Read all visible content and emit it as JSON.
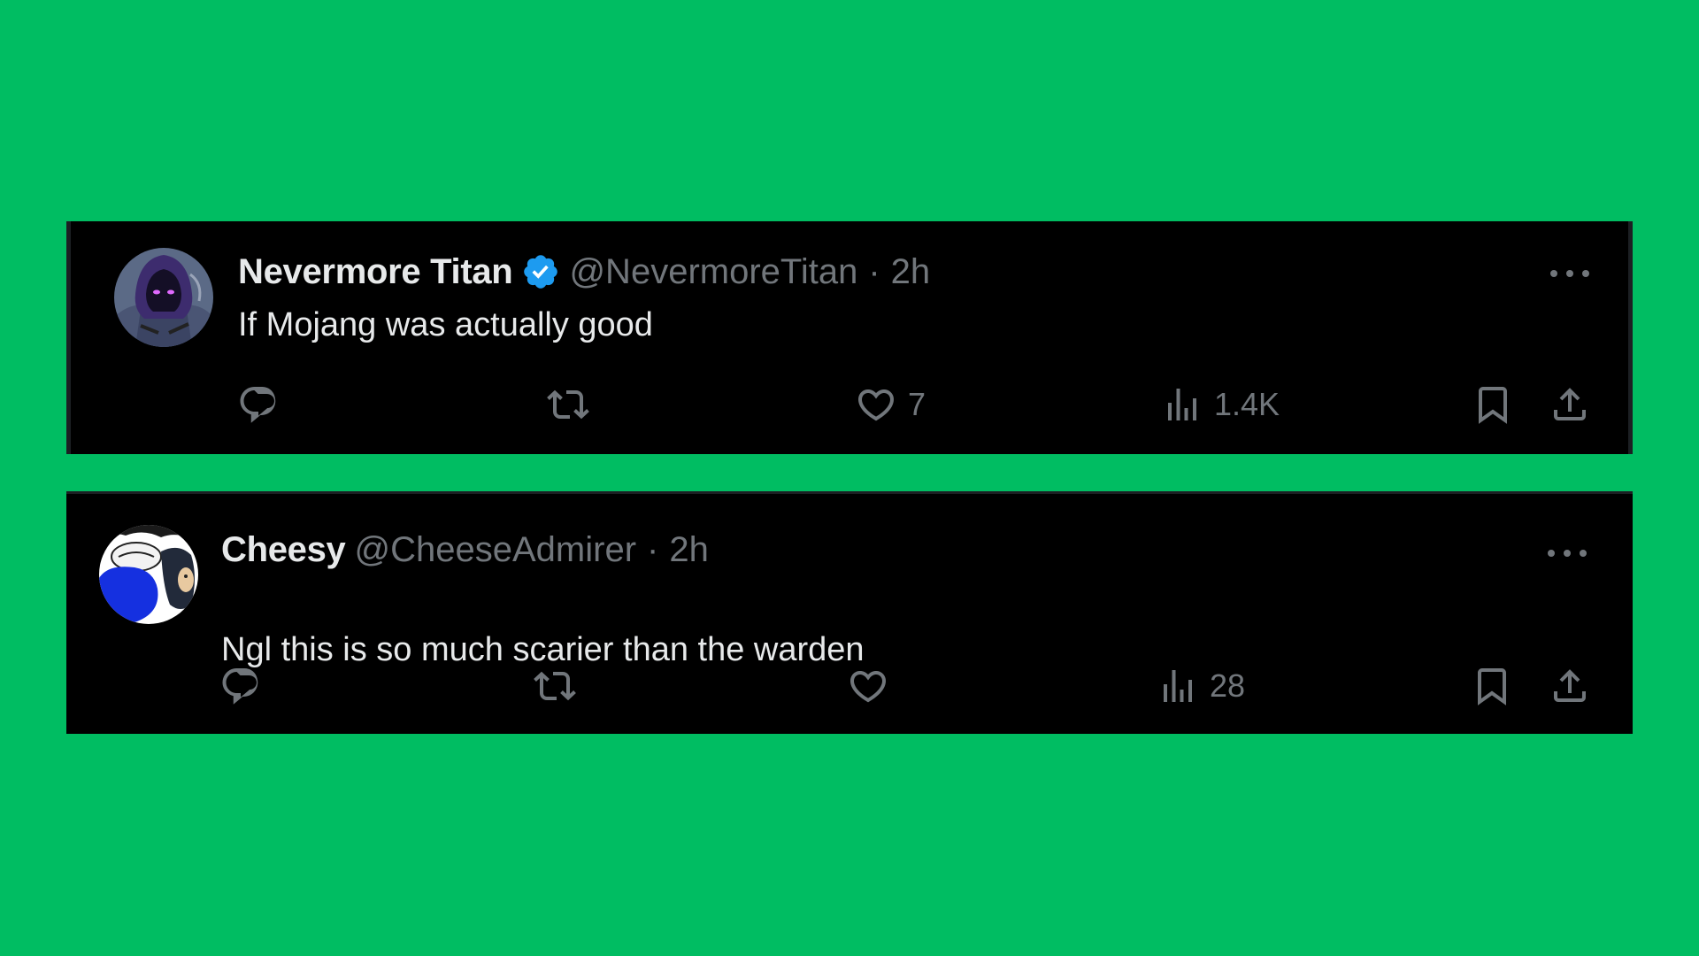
{
  "colors": {
    "background": "#00bd62",
    "card": "#000000",
    "primary_text": "#e7e9ea",
    "secondary_text": "#71767b",
    "verified": "#1d9bf0"
  },
  "tweets": [
    {
      "display_name": "Nevermore Titan",
      "verified": true,
      "handle": "@NevermoreTitan",
      "separator": "·",
      "time": "2h",
      "text": "If Mojang was actually good",
      "avatar_icon": "hooded-character-avatar",
      "actions": {
        "reply_count": "",
        "retweet_count": "",
        "like_count": "7",
        "views_count": "1.4K"
      }
    },
    {
      "display_name": "Cheesy",
      "verified": false,
      "handle": "@CheeseAdmirer",
      "separator": "·",
      "time": "2h",
      "text": "Ngl this is so much scarier than the warden",
      "avatar_icon": "cartoon-character-avatar",
      "actions": {
        "reply_count": "",
        "retweet_count": "",
        "like_count": "",
        "views_count": "28"
      }
    }
  ]
}
